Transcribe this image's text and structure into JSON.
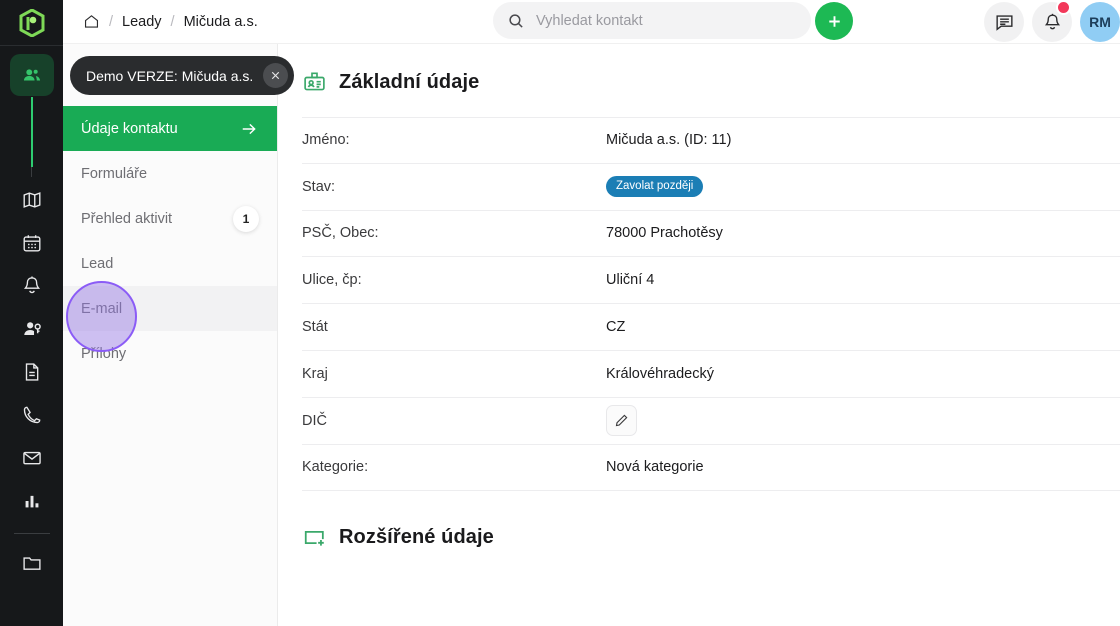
{
  "brand": {
    "logo_icon": "hexagon-r-logo-icon",
    "accent_green": "#19ab55",
    "rail_bg": "#16181a",
    "badge_blue": "#1b7eb5",
    "highlight_purple": "#8b5cf6"
  },
  "rail": {
    "items": [
      {
        "icon": "contacts-people-icon",
        "name": "contacts",
        "active": true
      },
      {
        "icon": "map-icon",
        "name": "map",
        "active": false
      },
      {
        "icon": "calendar-icon",
        "name": "calendar",
        "active": false
      },
      {
        "icon": "bell-icon",
        "name": "notifications",
        "active": false
      },
      {
        "icon": "user-key-icon",
        "name": "users-access",
        "active": false
      },
      {
        "icon": "document-icon",
        "name": "documents",
        "active": false
      },
      {
        "icon": "phone-icon",
        "name": "calls",
        "active": false
      },
      {
        "icon": "envelope-icon",
        "name": "mail",
        "active": false
      },
      {
        "icon": "bar-chart-icon",
        "name": "statistics",
        "active": false
      },
      {
        "icon": "folder-icon",
        "name": "files",
        "active": false
      }
    ]
  },
  "topbar": {
    "home_icon": "home-icon",
    "breadcrumb": [
      "Leady",
      "Mičuda a.s."
    ],
    "separator": "/",
    "search": {
      "icon": "search-icon",
      "value": "",
      "placeholder": "Vyhledat kontakt"
    },
    "add_button": {
      "icon": "plus-icon",
      "label": "+"
    },
    "messages_icon": "message-list-icon",
    "notifications_icon": "bell-icon",
    "has_notification": true,
    "avatar_initials": "RM"
  },
  "toast": {
    "text": "Demo VERZE: Mičuda a.s.",
    "close_icon": "close-icon"
  },
  "subnav": {
    "items": [
      {
        "label": "Údaje kontaktu",
        "state": "active",
        "arrow_icon": "arrow-right-icon",
        "badge": null
      },
      {
        "label": "Formuláře",
        "state": "default",
        "arrow_icon": null,
        "badge": null
      },
      {
        "label": "Přehled aktivit",
        "state": "default",
        "arrow_icon": null,
        "badge": "1"
      },
      {
        "label": "Lead",
        "state": "default",
        "arrow_icon": null,
        "badge": null
      },
      {
        "label": "E-mail",
        "state": "hover",
        "arrow_icon": null,
        "badge": null
      },
      {
        "label": "Přílohy",
        "state": "default",
        "arrow_icon": null,
        "badge": null
      }
    ]
  },
  "main": {
    "basic_section": {
      "icon": "id-badge-icon",
      "title": "Základní údaje",
      "rows": [
        {
          "key": "Jméno:",
          "value": "Mičuda a.s. (ID: 11)",
          "type": "text"
        },
        {
          "key": "Stav:",
          "value": "Zavolat později",
          "type": "badge"
        },
        {
          "key": "PSČ, Obec:",
          "value": "78000 Prachotěsy",
          "type": "text"
        },
        {
          "key": "Ulice, čp:",
          "value": "Uliční 4",
          "type": "text"
        },
        {
          "key": "Stát",
          "value": "CZ",
          "type": "text"
        },
        {
          "key": "Kraj",
          "value": "Královéhradecký",
          "type": "text"
        },
        {
          "key": "DIČ",
          "value": "",
          "type": "edit",
          "edit_icon": "pencil-icon"
        },
        {
          "key": "Kategorie:",
          "value": "Nová kategorie",
          "type": "text"
        }
      ]
    },
    "extended_section": {
      "icon": "add-box-icon",
      "title": "Rozšířené údaje"
    }
  }
}
